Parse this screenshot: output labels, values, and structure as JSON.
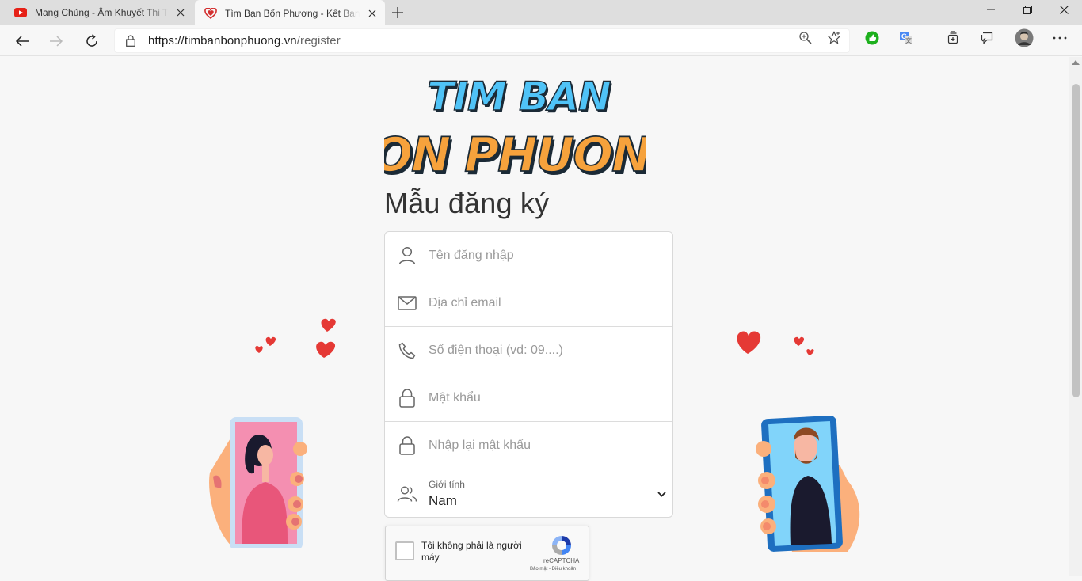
{
  "browser": {
    "tabs": [
      {
        "title": "Mang Chủng - Âm Khuyết Thi Thính",
        "active": false,
        "favicon": "youtube-icon"
      },
      {
        "title": "Tìm Bạn Bốn Phương - Kết Bạn Hẹn Hò",
        "active": true,
        "favicon": "heart-icon"
      }
    ],
    "url_host": "https://timbanbonphuong.vn",
    "url_path": "/register"
  },
  "logo": {
    "line1": "TIM BAN",
    "line2": "BON PHUONG"
  },
  "form": {
    "title": "Mẫu đăng ký",
    "username_placeholder": "Tên đăng nhập",
    "email_placeholder": "Địa chỉ email",
    "phone_placeholder": "Số điện thoại (vd: 09....)",
    "password_placeholder": "Mật khẩu",
    "confirm_placeholder": "Nhập lại mật khẩu",
    "gender_label": "Giới tính",
    "gender_value": "Nam"
  },
  "captcha": {
    "label": "Tôi không phải là người máy",
    "brand": "reCAPTCHA",
    "links": "Bảo mật - Điều khoản"
  },
  "colors": {
    "logo_blue": "#4fc3f7",
    "logo_orange": "#f6a23c",
    "heart_red": "#e53935",
    "phone_pink": "#f48fb1",
    "phone_blue": "#1e6fc0",
    "skin": "#fbb07c"
  }
}
